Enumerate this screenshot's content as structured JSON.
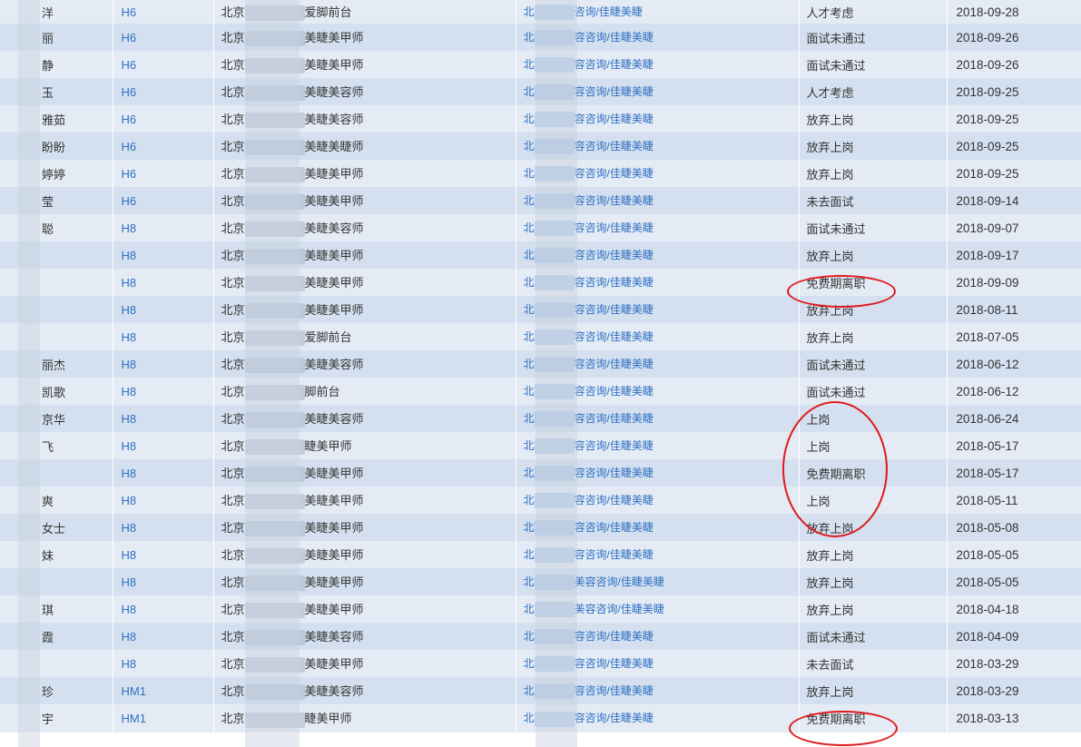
{
  "rows": [
    {
      "name": "洋",
      "level": "H6",
      "store": "北京",
      "store_tail": "爱脚前台",
      "company": "北",
      "company_tail": "咨询/佳睫美睫",
      "status": "人才考虑",
      "date": "2018-09-28"
    },
    {
      "name": "丽",
      "level": "H6",
      "store": "北京",
      "store_tail": "美睫美甲师",
      "company": "北",
      "company_tail": "容咨询/佳睫美睫",
      "status": "面试未通过",
      "date": "2018-09-26"
    },
    {
      "name": "静",
      "level": "H6",
      "store": "北京",
      "store_tail": "美睫美甲师",
      "company": "北",
      "company_tail": "容咨询/佳睫美睫",
      "status": "面试未通过",
      "date": "2018-09-26"
    },
    {
      "name": "玉",
      "level": "H6",
      "store": "北京",
      "store_tail": "美睫美容师",
      "company": "北",
      "company_tail": "容咨询/佳睫美睫",
      "status": "人才考虑",
      "date": "2018-09-25"
    },
    {
      "name": "雅茹",
      "level": "H6",
      "store": "北京",
      "store_tail": "美睫美容师",
      "company": "北",
      "company_tail": "容咨询/佳睫美睫",
      "status": "放弃上岗",
      "date": "2018-09-25"
    },
    {
      "name": "盼盼",
      "level": "H6",
      "store": "北京",
      "store_tail": "美睫美睫师",
      "company": "北",
      "company_tail": "容咨询/佳睫美睫",
      "status": "放弃上岗",
      "date": "2018-09-25"
    },
    {
      "name": "婷婷",
      "level": "H6",
      "store": "北京",
      "store_tail": "美睫美甲师",
      "company": "北",
      "company_tail": "容咨询/佳睫美睫",
      "status": "放弃上岗",
      "date": "2018-09-25"
    },
    {
      "name": "莹",
      "level": "H6",
      "store": "北京",
      "store_tail": "美睫美甲师",
      "company": "北",
      "company_tail": "容咨询/佳睫美睫",
      "status": "未去面试",
      "date": "2018-09-14"
    },
    {
      "name": "聪",
      "level": "H8",
      "store": "北京",
      "store_tail": "美睫美容师",
      "company": "北",
      "company_tail": "容咨询/佳睫美睫",
      "status": "面试未通过",
      "date": "2018-09-07"
    },
    {
      "name": "",
      "level": "H8",
      "store": "北京",
      "store_tail": "美睫美甲师",
      "company": "北",
      "company_tail": "容咨询/佳睫美睫",
      "status": "放弃上岗",
      "date": "2018-09-17"
    },
    {
      "name": "",
      "level": "H8",
      "store": "北京",
      "store_tail": "美睫美甲师",
      "company": "北",
      "company_tail": "容咨询/佳睫美睫",
      "status": "免费期离职",
      "date": "2018-09-09"
    },
    {
      "name": "",
      "level": "H8",
      "store": "北京",
      "store_tail": "美睫美甲师",
      "company": "北",
      "company_tail": "容咨询/佳睫美睫",
      "status": "放弃上岗",
      "date": "2018-08-11"
    },
    {
      "name": "",
      "level": "H8",
      "store": "北京",
      "store_tail": "爱脚前台",
      "company": "北",
      "company_tail": "容咨询/佳睫美睫",
      "status": "放弃上岗",
      "date": "2018-07-05"
    },
    {
      "name": "丽杰",
      "level": "H8",
      "store": "北京",
      "store_tail": "美睫美容师",
      "company": "北",
      "company_tail": "容咨询/佳睫美睫",
      "status": "面试未通过",
      "date": "2018-06-12"
    },
    {
      "name": "凯歌",
      "level": "H8",
      "store": "北京",
      "store_tail": "脚前台",
      "company": "北",
      "company_tail": "容咨询/佳睫美睫",
      "status": "面试未通过",
      "date": "2018-06-12"
    },
    {
      "name": "京华",
      "level": "H8",
      "store": "北京",
      "store_tail": "美睫美容师",
      "company": "北",
      "company_tail": "容咨询/佳睫美睫",
      "status": "上岗",
      "date": "2018-06-24"
    },
    {
      "name": "飞",
      "level": "H8",
      "store": "北京",
      "store_tail": "睫美甲师",
      "company": "北",
      "company_tail": "容咨询/佳睫美睫",
      "status": "上岗",
      "date": "2018-05-17"
    },
    {
      "name": "",
      "level": "H8",
      "store": "北京",
      "store_tail": "美睫美甲师",
      "company": "北",
      "company_tail": "容咨询/佳睫美睫",
      "status": "免费期离职",
      "date": "2018-05-17"
    },
    {
      "name": "爽",
      "level": "H8",
      "store": "北京",
      "store_tail": "美睫美甲师",
      "company": "北",
      "company_tail": "容咨询/佳睫美睫",
      "status": "上岗",
      "date": "2018-05-11"
    },
    {
      "name": "女士",
      "level": "H8",
      "store": "北京",
      "store_tail": "美睫美甲师",
      "company": "北",
      "company_tail": "容咨询/佳睫美睫",
      "status": "放弃上岗",
      "date": "2018-05-08"
    },
    {
      "name": "妹",
      "level": "H8",
      "store": "北京",
      "store_tail": "美睫美甲师",
      "company": "北",
      "company_tail": "容咨询/佳睫美睫",
      "status": "放弃上岗",
      "date": "2018-05-05"
    },
    {
      "name": "",
      "level": "H8",
      "store": "北京",
      "store_tail": "美睫美甲师",
      "company": "北",
      "company_tail": "美容咨询/佳睫美睫",
      "status": "放弃上岗",
      "date": "2018-05-05"
    },
    {
      "name": "琪",
      "level": "H8",
      "store": "北京",
      "store_tail": "美睫美甲师",
      "company": "北",
      "company_tail": "美容咨询/佳睫美睫",
      "status": "放弃上岗",
      "date": "2018-04-18"
    },
    {
      "name": "霞",
      "level": "H8",
      "store": "北京",
      "store_tail": "美睫美容师",
      "company": "北",
      "company_tail": "容咨询/佳睫美睫",
      "status": "面试未通过",
      "date": "2018-04-09"
    },
    {
      "name": "",
      "level": "H8",
      "store": "北京",
      "store_tail": "美睫美甲师",
      "company": "北",
      "company_tail": "容咨询/佳睫美睫",
      "status": "未去面试",
      "date": "2018-03-29"
    },
    {
      "name": "珍",
      "level": "HM1",
      "store": "北京",
      "store_tail": "美睫美容师",
      "company": "北",
      "company_tail": "容咨询/佳睫美睫",
      "status": "放弃上岗",
      "date": "2018-03-29"
    },
    {
      "name": "宇",
      "level": "HM1",
      "store": "北京",
      "store_tail": "睫美甲师",
      "company": "北",
      "company_tail": "容咨询/佳睫美睫",
      "status": "免费期离职",
      "date": "2018-03-13"
    }
  ],
  "colors": {
    "row_odd": "#e4ebf5",
    "row_even": "#d4e0ef",
    "link": "#2d6fc2",
    "annotation": "#e0181b"
  }
}
